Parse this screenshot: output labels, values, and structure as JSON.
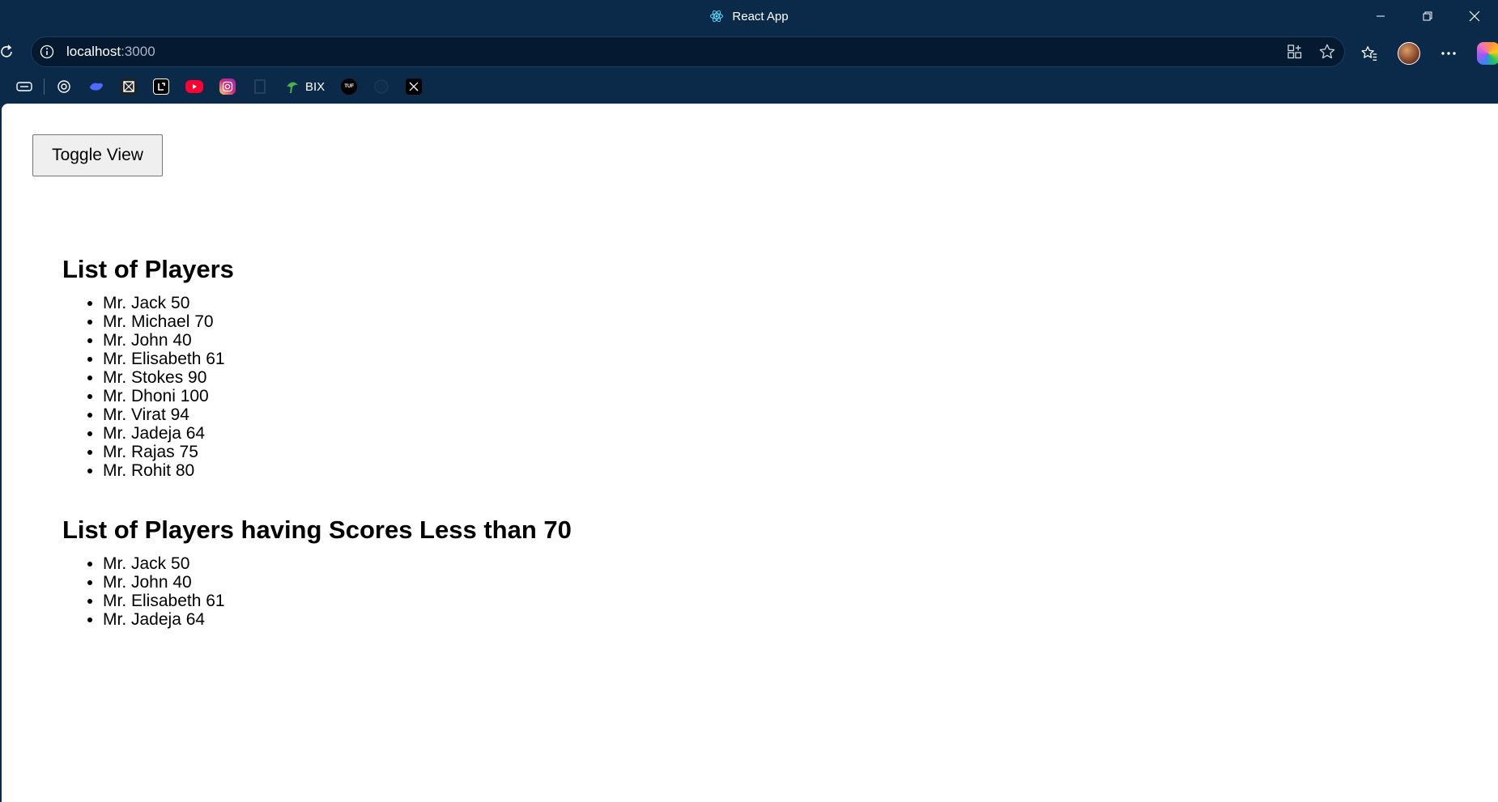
{
  "window": {
    "title": "React App",
    "controls": [
      "minimize",
      "restore",
      "close"
    ]
  },
  "address_bar": {
    "host": "localhost",
    "port": ":3000"
  },
  "bookmarks": [
    {
      "icon": "tab-icon"
    },
    {
      "icon": "chatgpt-icon"
    },
    {
      "icon": "deepseek-icon"
    },
    {
      "icon": "app-icon"
    },
    {
      "icon": "leetcode-icon"
    },
    {
      "icon": "youtube-icon"
    },
    {
      "icon": "instagram-icon"
    },
    {
      "icon": "blank-icon"
    },
    {
      "icon": "bix-icon",
      "label": "BIX"
    },
    {
      "icon": "tuf-icon",
      "label_glyph": "TUF"
    },
    {
      "icon": "github-icon"
    },
    {
      "icon": "x-icon"
    }
  ],
  "page": {
    "toggle_button": "Toggle View",
    "all_players": {
      "heading": "List of Players",
      "items": [
        "Mr. Jack 50",
        "Mr. Michael 70",
        "Mr. John 40",
        "Mr. Elisabeth 61",
        "Mr. Stokes 90",
        "Mr. Dhoni 100",
        "Mr. Virat 94",
        "Mr. Jadeja 64",
        "Mr. Rajas 75",
        "Mr. Rohit 80"
      ]
    },
    "low_scorers": {
      "heading": "List of Players having Scores Less than 70",
      "items": [
        "Mr. Jack 50",
        "Mr. John 40",
        "Mr. Elisabeth 61",
        "Mr. Jadeja 64"
      ]
    }
  },
  "colors": {
    "chrome": "#0b2a4a",
    "omnibox": "#051a30",
    "page_bg": "#ffffff"
  }
}
